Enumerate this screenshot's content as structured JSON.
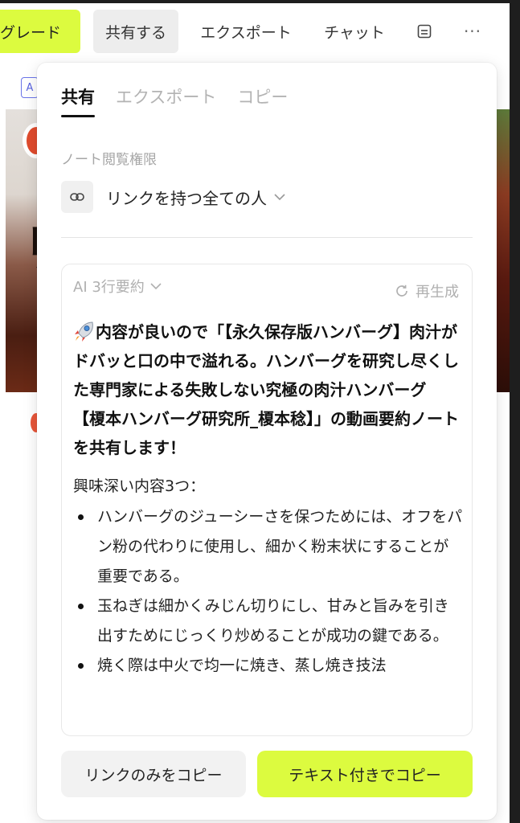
{
  "colors": {
    "accent": "#dcfb3f",
    "tab_active": "#111111",
    "muted": "#b0b0b0"
  },
  "toolbar": {
    "upgrade_label": "グレード",
    "share_label": "共有する",
    "export_label": "エクスポート",
    "chat_label": "チャット",
    "save_icon": "save-icon",
    "more_label": "···"
  },
  "background": {
    "badge": "A"
  },
  "panel": {
    "tabs": [
      {
        "label": "共有",
        "active": true
      },
      {
        "label": "エクスポート",
        "active": false
      },
      {
        "label": "コピー",
        "active": false
      }
    ],
    "permission": {
      "label": "ノート閲覧権限",
      "icon": "link-icon",
      "value": "リンクを持つ全ての人"
    },
    "summary": {
      "mode_label": "AI 3行要約",
      "regenerate_label": "再生成",
      "intro": "内容が良いので「【永久保存版ハンバーグ】肉汁がドバッと口の中で溢れる。ハンバーグを研究し尽くした専門家による失敗しない究極の肉汁ハンバーグ 【榎本ハンバーグ研究所_榎本稔】」の動画要約ノートを共有します！",
      "points_heading": "興味深い内容3つ：",
      "points": [
        "ハンバーグのジューシーさを保つためには、オフをパン粉の代わりに使用し、細かく粉末状にすることが重要である。",
        "玉ねぎは細かくみじん切りにし、甘みと旨みを引き出すためにじっくり炒めることが成功の鍵である。",
        "焼く際は中火で均一に焼き、蒸し焼き技法"
      ]
    },
    "buttons": {
      "copy_link": "リンクのみをコピー",
      "copy_with_text": "テキスト付きでコピー"
    }
  }
}
